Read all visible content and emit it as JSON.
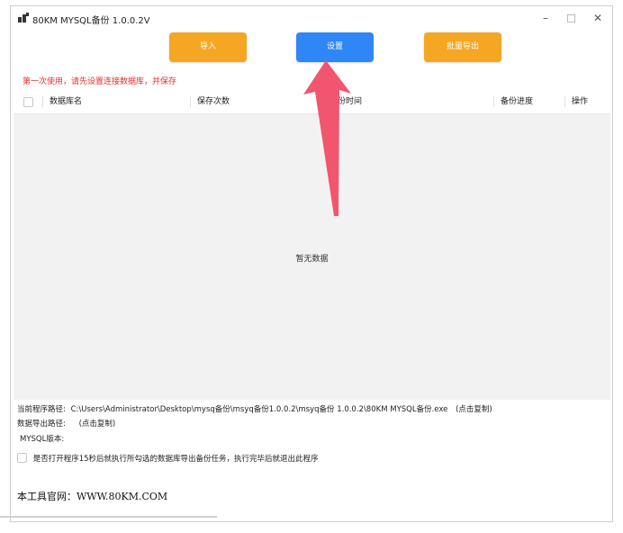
{
  "window": {
    "title": "80KM MYSQL备份 1.0.0.2V"
  },
  "toolbar": {
    "import_label": "导入",
    "settings_label": "设置",
    "batch_export_label": "批量导出"
  },
  "hint": "第一次使用，请先设置连接数据库，并保存",
  "table": {
    "columns": [
      "数据库名",
      "保存次数",
      "备份时间",
      "备份进度",
      "操作"
    ],
    "empty_text": "暂无数据"
  },
  "info": {
    "program_path_label": "当前程序路径:",
    "program_path_value": "C:\\Users\\Administrator\\Desktop\\mysq备份\\msyq备份1.0.0.2\\msyq备份 1.0.0.2\\80KM MYSQL备份.exe",
    "program_path_copy": "(点击复制)",
    "export_path_label": "数据导出路径:",
    "export_path_copy": "(点击复制)",
    "mysql_version_label": "MYSQL版本:",
    "auto_run_label": "是否打开程序15秒后就执行所勾选的数据库导出备份任务，执行完毕后就退出此程序",
    "site_text": "本工具官网：WWW.80KM.COM"
  },
  "colors": {
    "orange": "#f5a623",
    "blue": "#2f86f6",
    "hint_red": "#e62e2e",
    "arrow": "#f2566e"
  }
}
